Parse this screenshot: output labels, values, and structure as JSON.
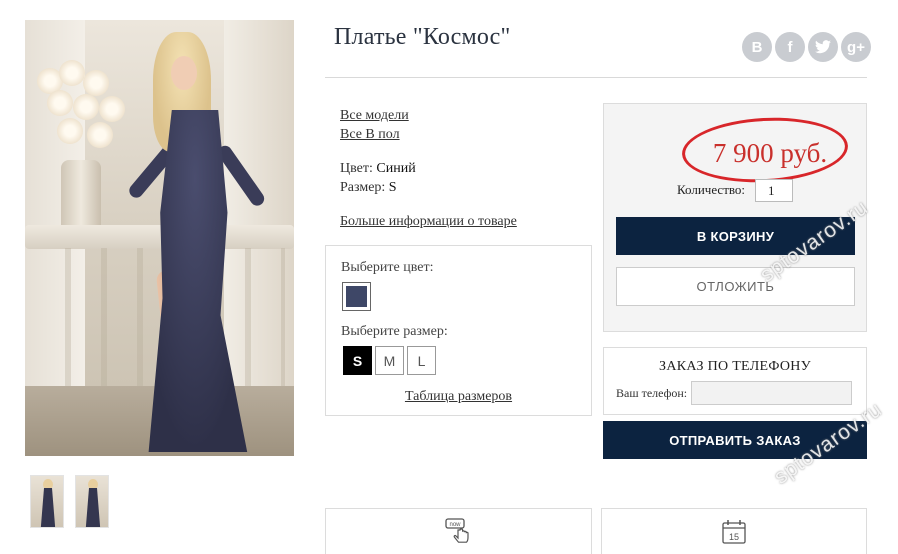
{
  "product": {
    "title": "Платье \"Космос\"",
    "links": {
      "all_models": "Все модели",
      "all_in_category": "Все В пол",
      "more_info": "Больше информации о товаре"
    },
    "specs": {
      "color_label": "Цвет:",
      "color_value": "Синий",
      "size_label": "Размер:",
      "size_value": "S"
    }
  },
  "social": {
    "items": [
      {
        "icon": "vk-icon",
        "glyph": "B"
      },
      {
        "icon": "facebook-icon",
        "glyph": "f"
      },
      {
        "icon": "twitter-icon",
        "glyph": "t"
      },
      {
        "icon": "google-plus-icon",
        "glyph": "g+"
      }
    ]
  },
  "options": {
    "color_label": "Выберите цвет:",
    "color_swatch": "#3e4767",
    "size_label": "Выберите размер:",
    "sizes": [
      "S",
      "M",
      "L"
    ],
    "selected_size": "S",
    "size_table_link": "Таблица размеров"
  },
  "buy": {
    "price": "7 900 руб.",
    "quantity_label": "Количество:",
    "quantity_value": "1",
    "cart_button": "В КОРЗИНУ",
    "later_button": "ОТЛОЖИТЬ"
  },
  "phone_order": {
    "title": "ЗАКАЗ ПО ТЕЛЕФОНУ",
    "phone_label": "Ваш телефон:",
    "phone_value": "",
    "send_button": "ОТПРАВИТЬ ЗАКАЗ"
  },
  "cards": {
    "left_icon": "now-hand-icon",
    "right_icon": "calendar-icon",
    "right_icon_day": "15"
  },
  "watermark": "sptovarov.ru",
  "colors": {
    "dark_button": "#0c2340",
    "price": "#c9302c",
    "price_ring": "#d8262a",
    "title": "#2b3340"
  }
}
